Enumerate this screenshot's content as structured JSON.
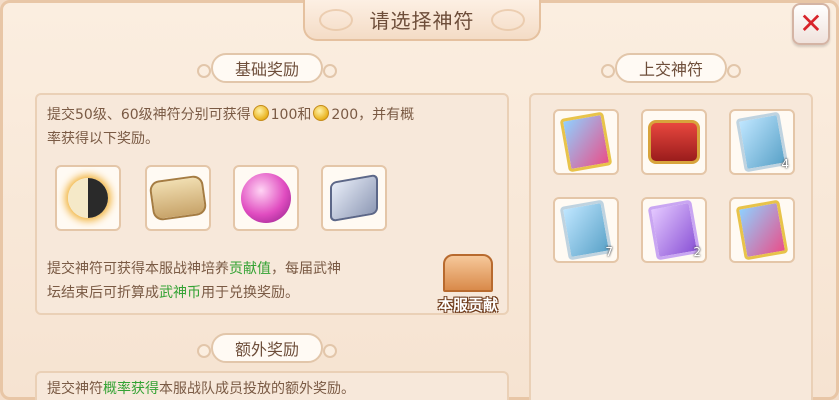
{
  "dialog": {
    "title": "请选择神符",
    "close_label": "✕"
  },
  "basic_rewards": {
    "header": "基础奖励",
    "desc_part1": "提交50级、60级神符分别可获得",
    "coin_amount_1": "100和",
    "coin_amount_2": "200，并有概",
    "desc_part2": "率获得以下奖励。",
    "items": [
      {
        "icon": "yin-yang-orb-icon"
      },
      {
        "icon": "scroll-icon"
      },
      {
        "icon": "pink-orb-icon"
      },
      {
        "icon": "stone-tablet-icon"
      }
    ],
    "contrib_desc_1_a": "提交神符可获得本服战神培养",
    "contrib_desc_1_green": "贡献值",
    "contrib_desc_1_b": "，每届武神",
    "contrib_desc_2_a": "坛结束后可折算成",
    "contrib_desc_2_green": "武神币",
    "contrib_desc_2_b": "用于兑换奖励。",
    "contrib_badge": "本服贡献"
  },
  "extra_rewards": {
    "header": "额外奖励",
    "desc_a": "提交神符",
    "desc_green": "概率获得",
    "desc_b": "本服战队成员投放的额外奖励。"
  },
  "submit_runes": {
    "header": "上交神符",
    "slots": [
      {
        "icon": "gold-rune-card-icon",
        "count": ""
      },
      {
        "icon": "red-treasure-chest-icon",
        "count": ""
      },
      {
        "icon": "silver-rune-card-icon",
        "count": "4"
      },
      {
        "icon": "silver-rune-card-icon",
        "count": "7"
      },
      {
        "icon": "purple-rune-card-icon",
        "count": "2"
      },
      {
        "icon": "gold-rune-card-icon",
        "count": ""
      }
    ]
  },
  "colors": {
    "accent_green": "#33a233",
    "close_red": "#d8232a",
    "panel_bg": "#fbeee0"
  }
}
